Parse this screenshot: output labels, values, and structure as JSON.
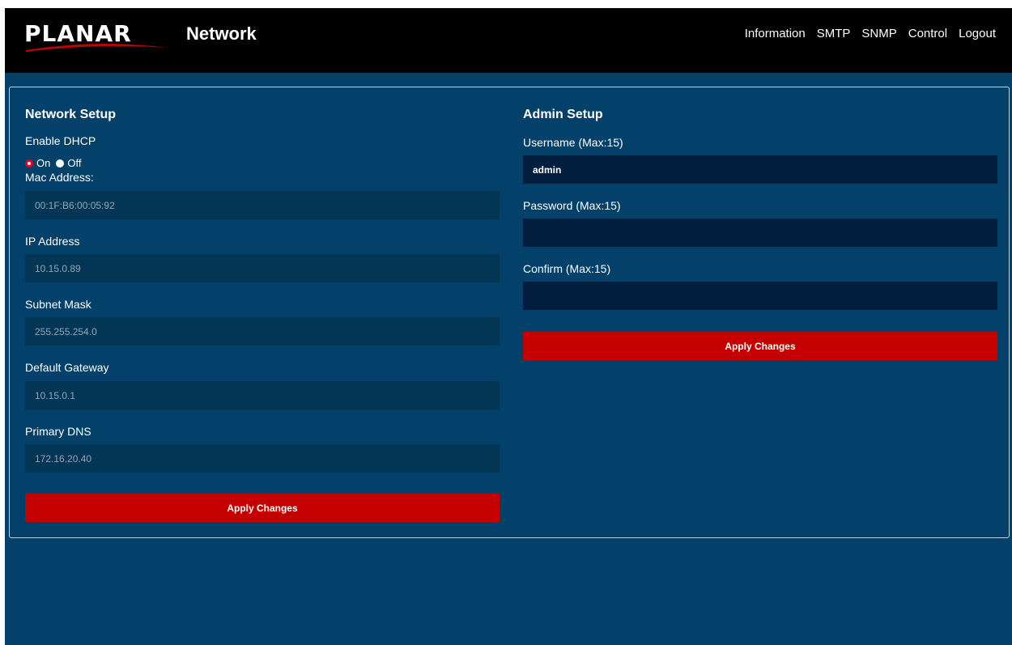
{
  "header": {
    "logo_text": "PLANAR",
    "page_title": "Network",
    "nav": [
      "Information",
      "SMTP",
      "SNMP",
      "Control",
      "Logout"
    ]
  },
  "network_setup": {
    "title": "Network Setup",
    "dhcp_label": "Enable DHCP",
    "dhcp_on_label": "On",
    "dhcp_off_label": "Off",
    "dhcp_selected": "On",
    "mac_label": "Mac Address:",
    "mac_value": "00:1F:B6:00:05:92",
    "ip_label": "IP Address",
    "ip_value": "10.15.0.89",
    "subnet_label": "Subnet Mask",
    "subnet_value": "255.255.254.0",
    "gateway_label": "Default Gateway",
    "gateway_value": "10.15.0.1",
    "dns_label": "Primary DNS",
    "dns_value": "172.16.20.40",
    "apply_label": "Apply Changes"
  },
  "admin_setup": {
    "title": "Admin Setup",
    "username_label": "Username (Max:15)",
    "username_value": "admin",
    "password_label": "Password (Max:15)",
    "password_value": "",
    "confirm_label": "Confirm (Max:15)",
    "confirm_value": "",
    "apply_label": "Apply Changes"
  },
  "colors": {
    "background": "#03416b",
    "header": "#000000",
    "button": "#c40000",
    "input_disabled": "#033554",
    "input_active": "#011e3f"
  }
}
